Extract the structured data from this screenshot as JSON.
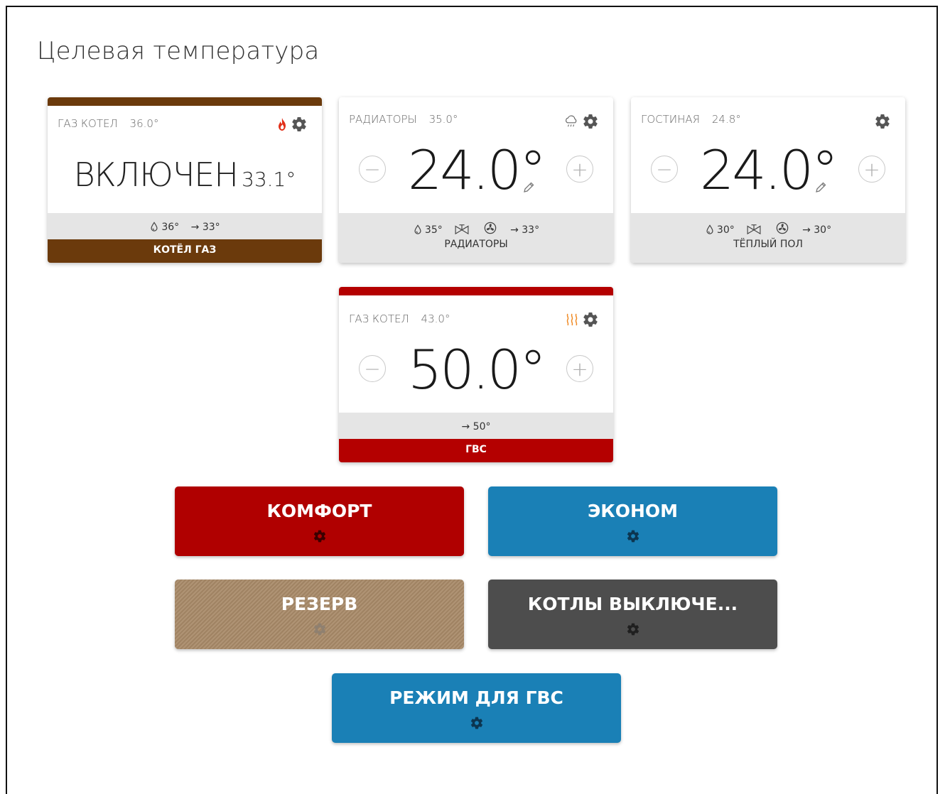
{
  "page": {
    "title": "Целевая температура"
  },
  "cards": {
    "boiler": {
      "name": "ГАЗ КОТЕЛ",
      "temp": "36.0°",
      "status": "ВКЛЮЧЕН",
      "status_temp": "33.1°",
      "drop": "36°",
      "arrow": "→ 33°",
      "label": "КОТЁЛ ГАЗ",
      "strip_color": "#6b3a0c",
      "band_color": "#6b3a0c"
    },
    "radiators": {
      "name": "РАДИАТОРЫ",
      "temp": "35.0°",
      "setpoint": "24.0°",
      "drop": "35°",
      "arrow": "→ 33°",
      "label": "РАДИАТОРЫ"
    },
    "living": {
      "name": "ГОСТИНАЯ",
      "temp": "24.8°",
      "setpoint": "24.0°",
      "drop": "30°",
      "arrow": "→ 30°",
      "label": "ТЁПЛЫЙ ПОЛ"
    },
    "dhw": {
      "name": "ГАЗ КОТЕЛ",
      "temp": "43.0°",
      "setpoint": "50.0°",
      "arrow": "→ 50°",
      "label": "ГВС",
      "strip_color": "#b40000",
      "band_color": "#b40000"
    }
  },
  "modes": {
    "comfort": {
      "label": "КОМФОРТ",
      "color": "#b00000"
    },
    "econom": {
      "label": "ЭКОНОМ",
      "color": "#1a80b6"
    },
    "reserve": {
      "label": "РЕЗЕРВ",
      "color": "#a88a68"
    },
    "boilers_off": {
      "label": "КОТЛЫ ВЫКЛЮЧЕ...",
      "color": "#4d4d4d"
    },
    "dhw_mode": {
      "label": "РЕЖИМ ДЛЯ ГВС",
      "color": "#1a80b6"
    }
  },
  "icons": {
    "settings": "gear-icon",
    "flame": "flame-icon",
    "weather": "weather-cloud-icon",
    "heat": "heat-waves-icon",
    "drop": "drop-icon",
    "valve": "valve-icon",
    "fan": "fan-icon",
    "edit": "pencil-icon"
  }
}
